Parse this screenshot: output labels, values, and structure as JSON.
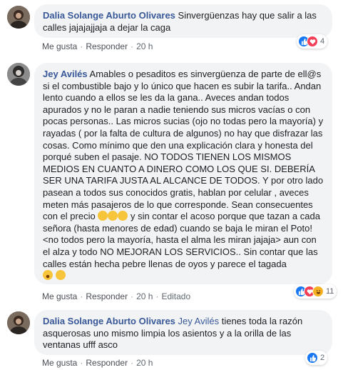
{
  "comments": [
    {
      "author": "Dalia Solange Aburto Olivares",
      "text": " Sinvergüenzas hay que salir a las calles jajajajjaja a dejar la caga",
      "actions": {
        "like": "Me gusta",
        "reply": "Responder",
        "time": "20 h"
      },
      "reactions": {
        "count": "4",
        "types": [
          "like",
          "love"
        ]
      }
    },
    {
      "author": "Jey Avilés",
      "text": " Amables o pesaditos es sinvergüenza de parte de ell@s si el combustible bajo y lo único que hacen es subir la tarifa.. Andan lento cuando a ellos se les da la gana.. Aveces andan todos apurados y no le paran a nadie teniendo sus micros vacías o con pocas personas.. Las micros sucias (ojo no todas pero la mayoría) y rayadas ( por la falta de cultura de algunos) no hay que disfrazar las cosas. Como mínimo que den una explicación clara y honesta del porqué suben el pasaje. NO TODOS TIENEN LOS MISMOS MEDIOS EN CUANTO A DINERO COMO LOS QUE SI. DEBERÍA SER UNA TARIFA JUSTA AL ALCANCE DE TODOS. Y por otro lado pasean a todos sus conocidos gratis, hablan por celular , aveces meten más pasajeros de lo que corresponde. Sean consecuentes con el precio",
      "text2": "y sin contar el acoso porque que tazan a cada señora (hasta menores de edad) cuando se baja le miran el Poto! <no todos pero la mayoría, hasta el alma les miran jajaja> aun con el alza y todo NO MEJORAN LOS SERVICIOS.. Sin contar que las calles están hecha pebre llenas de oyos y parece el tagada",
      "actions": {
        "like": "Me gusta",
        "reply": "Responder",
        "time": "20 h",
        "edited": "Editado"
      },
      "reactions": {
        "count": "11",
        "types": [
          "like",
          "love",
          "haha"
        ]
      }
    },
    {
      "author": "Dalia Solange Aburto Olivares",
      "mention": "Jey Avilés",
      "text": " tienes toda la razón asquerosas uno mismo limpia los asientos y a la orilla de las ventanas ufff asco",
      "actions": {
        "like": "Me gusta",
        "reply": "Responder",
        "time": "20 h"
      },
      "reactions": {
        "count": "2",
        "types": [
          "like"
        ]
      }
    }
  ]
}
